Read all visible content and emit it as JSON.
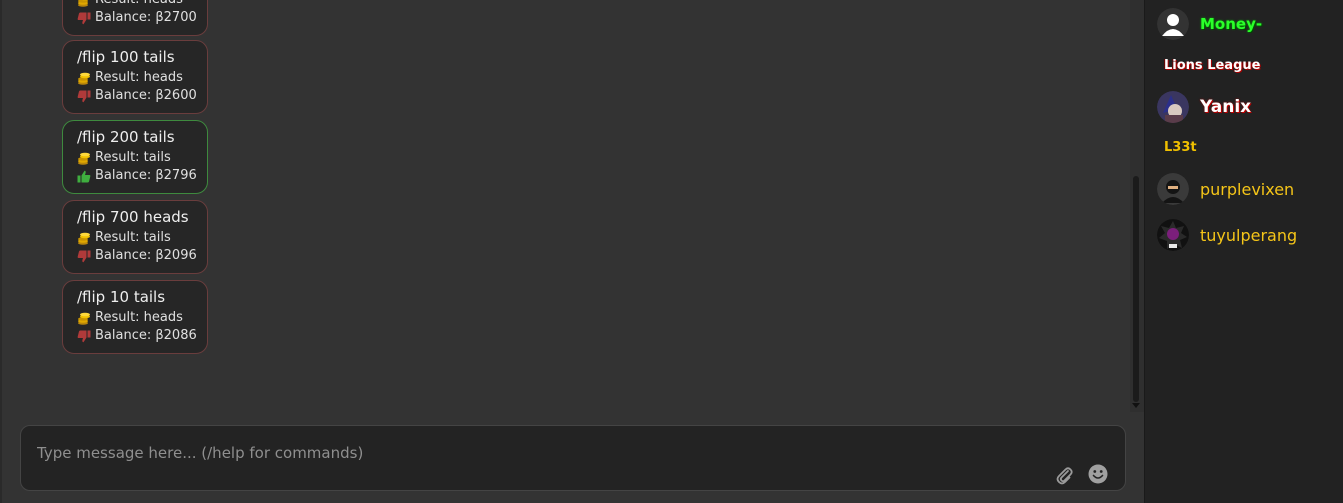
{
  "chat": {
    "messages": [
      {
        "command": "",
        "result": "Result: heads",
        "balance": "Balance: β2700",
        "outcome": "loss"
      },
      {
        "command": "/flip 100 tails",
        "result": "Result: heads",
        "balance": "Balance: β2600",
        "outcome": "loss"
      },
      {
        "command": "/flip 200 tails",
        "result": "Result: tails",
        "balance": "Balance: β2796",
        "outcome": "win"
      },
      {
        "command": "/flip 700 heads",
        "result": "Result: tails",
        "balance": "Balance: β2096",
        "outcome": "loss"
      },
      {
        "command": "/flip 10 tails",
        "result": "Result: heads",
        "balance": "Balance: β2086",
        "outcome": "loss"
      }
    ],
    "icons": {
      "result": "coins-icon",
      "win": "thumbs-up-icon",
      "loss": "thumbs-down-icon",
      "attach": "paperclip-icon",
      "emoji": "smiley-icon"
    }
  },
  "composer": {
    "placeholder": "Type message here... (/help for commands)",
    "value": ""
  },
  "sidebar": {
    "top_user": "Money-",
    "groups": [
      {
        "name": "Lions League",
        "users": [
          "Yanix"
        ]
      },
      {
        "name": "L33t",
        "users": [
          "purplevixen",
          "tuyulperang"
        ]
      }
    ]
  },
  "colors": {
    "chat_bg": "#333333",
    "sidebar_bg": "#222222",
    "bubble_bg": "#262626",
    "loss_border": "#6a3d3d",
    "win_border": "#3e8a3e",
    "loss_icon": "#b03a3a",
    "win_icon": "#3fae3f",
    "l33t_gold": "#f5c518",
    "money_green": "#2bff2b"
  }
}
